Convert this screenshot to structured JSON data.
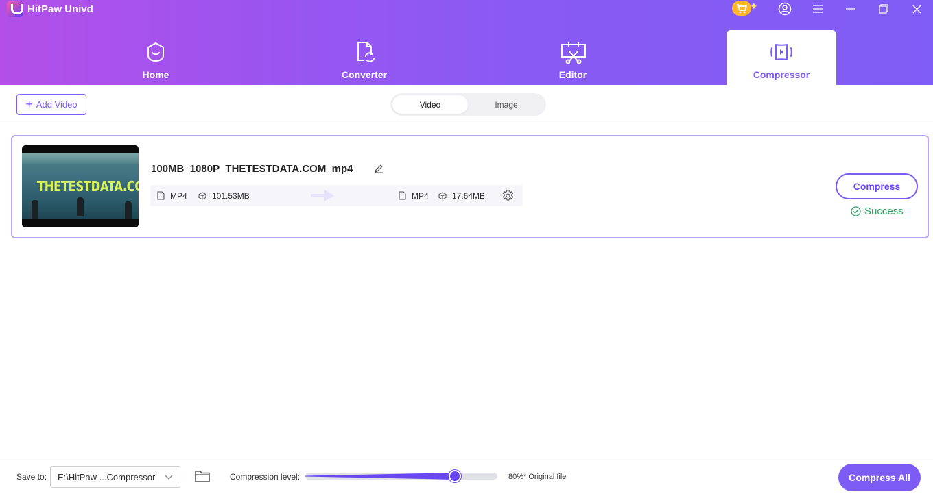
{
  "app": {
    "title": "HitPaw Univd"
  },
  "window_controls": [
    "cart-icon",
    "account-icon",
    "menu-icon",
    "minimize-icon",
    "restore-icon",
    "close-icon"
  ],
  "nav": {
    "tabs": [
      {
        "label": "Home",
        "icon": "home-icon",
        "active": false
      },
      {
        "label": "Converter",
        "icon": "converter-icon",
        "active": false
      },
      {
        "label": "Editor",
        "icon": "editor-icon",
        "active": false
      },
      {
        "label": "Compressor",
        "icon": "compressor-icon",
        "active": true
      }
    ]
  },
  "toolbar": {
    "add_video_label": "Add Video",
    "segments": [
      {
        "label": "Video",
        "active": true
      },
      {
        "label": "Image",
        "active": false
      }
    ]
  },
  "file": {
    "thumbnail_text": "THETESTDATA.COM",
    "name": "100MB_1080P_THETESTDATA.COM_mp4",
    "source_format": "MP4",
    "source_size": "101.53MB",
    "output_format": "MP4",
    "output_size": "17.64MB",
    "compress_label": "Compress",
    "status": "Success"
  },
  "footer": {
    "save_to_label": "Save to:",
    "save_path": "E:\\HitPaw ...Compressor",
    "compression_label": "Compression level:",
    "compression_level": 0.78,
    "compression_value_text": "80%* Original file",
    "compress_all_label": "Compress All"
  },
  "colors": {
    "accent": "#7c5cf5",
    "header_gradient_start": "#b34fe8",
    "header_gradient_end": "#7f5cf5",
    "success": "#1fa45a"
  }
}
